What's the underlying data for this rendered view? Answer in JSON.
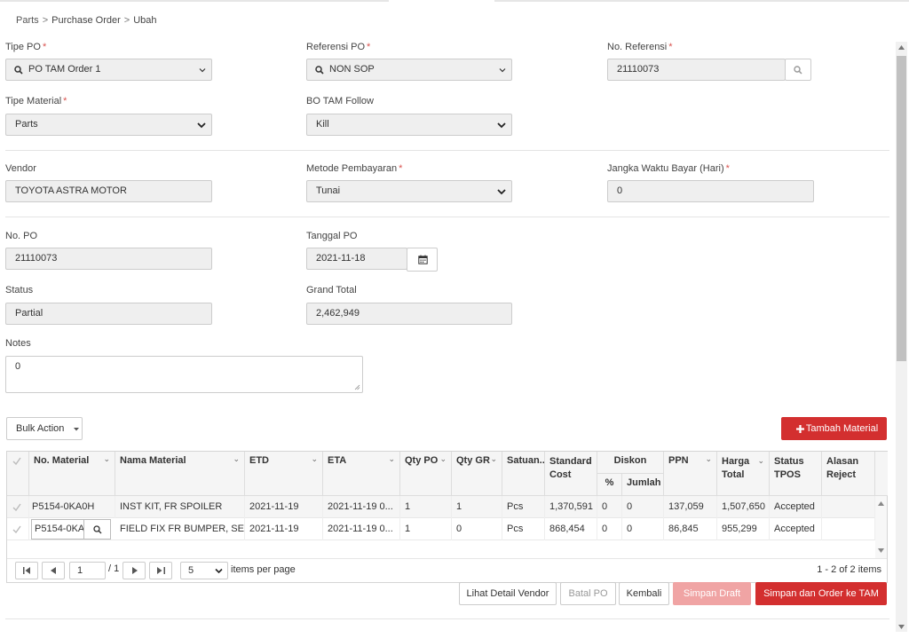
{
  "breadcrumb": {
    "items": [
      "Parts",
      "Purchase Order",
      "Ubah"
    ],
    "separator": ">"
  },
  "form": {
    "tipe_po": {
      "label": "Tipe PO",
      "required": "*",
      "value": "PO TAM Order 1"
    },
    "referensi_po": {
      "label": "Referensi PO",
      "required": "*",
      "value": "NON SOP"
    },
    "no_referensi": {
      "label": "No. Referensi",
      "required": "*",
      "value": "21110073"
    },
    "tipe_material": {
      "label": "Tipe Material",
      "required": "*",
      "value": "Parts"
    },
    "bo_tam_follow": {
      "label": "BO TAM Follow",
      "value": "Kill"
    },
    "vendor": {
      "label": "Vendor",
      "value": "TOYOTA ASTRA MOTOR"
    },
    "metode_pembayaran": {
      "label": "Metode Pembayaran",
      "required": "*",
      "value": "Tunai"
    },
    "jangka_waktu": {
      "label": "Jangka Waktu Bayar (Hari)",
      "required": "*",
      "value": "0"
    },
    "no_po": {
      "label": "No. PO",
      "value": "21110073"
    },
    "tanggal_po": {
      "label": "Tanggal PO",
      "value": "2021-11-18"
    },
    "status": {
      "label": "Status",
      "value": "Partial"
    },
    "grand_total": {
      "label": "Grand Total",
      "value": "2,462,949"
    },
    "notes": {
      "label": "Notes",
      "value": "0"
    }
  },
  "toolbar": {
    "bulk_action": "Bulk Action",
    "tambah_material": "Tambah Material"
  },
  "grid": {
    "headers": {
      "no_material": "No. Material",
      "nama_material": "Nama Material",
      "etd": "ETD",
      "eta": "ETA",
      "qty_po": "Qty PO",
      "qty_gr": "Qty GR",
      "satuan": "Satuan...",
      "standard_cost_1": "Standard",
      "standard_cost_2": "Cost",
      "diskon": "Diskon",
      "diskon_pct": "%",
      "diskon_jumlah": "Jumlah",
      "ppn": "PPN",
      "harga_total_1": "Harga",
      "harga_total_2": "Total",
      "status_tpos_1": "Status",
      "status_tpos_2": "TPOS",
      "alasan_reject_1": "Alasan",
      "alasan_reject_2": "Reject"
    },
    "rows": [
      {
        "no_material": "P5154-0KA0H",
        "nama_material": "INST KIT, FR SPOILER",
        "etd": "2021-11-19",
        "eta": "2021-11-19 0...",
        "qty_po": "1",
        "qty_gr": "1",
        "satuan": "Pcs",
        "standard_cost": "1,370,591",
        "diskon_pct": "0",
        "diskon_jumlah": "0",
        "ppn": "137,059",
        "harga_total": "1,507,650",
        "status_tpos": "Accepted",
        "alasan_reject": ""
      },
      {
        "no_material": "P5154-0KA",
        "nama_material": "FIELD FIX FR BUMPER, SET",
        "etd": "2021-11-19",
        "eta": "2021-11-19 0...",
        "qty_po": "1",
        "qty_gr": "0",
        "satuan": "Pcs",
        "standard_cost": "868,454",
        "diskon_pct": "0",
        "diskon_jumlah": "0",
        "ppn": "86,845",
        "harga_total": "955,299",
        "status_tpos": "Accepted",
        "alasan_reject": ""
      }
    ],
    "pager": {
      "page": "1",
      "of_label": "/ 1",
      "page_size": "5",
      "items_per_page": "items per page",
      "summary": "1 - 2 of 2 items"
    }
  },
  "actions": {
    "lihat_detail_vendor": "Lihat Detail Vendor",
    "batal_po": "Batal PO",
    "kembali": "Kembali",
    "simpan_draft": "Simpan Draft",
    "simpan_order": "Simpan dan Order ke TAM"
  },
  "colors": {
    "accent_red": "#d32f2f",
    "disabled_pink": "#f0a4a4",
    "field_bg": "#efefef"
  }
}
